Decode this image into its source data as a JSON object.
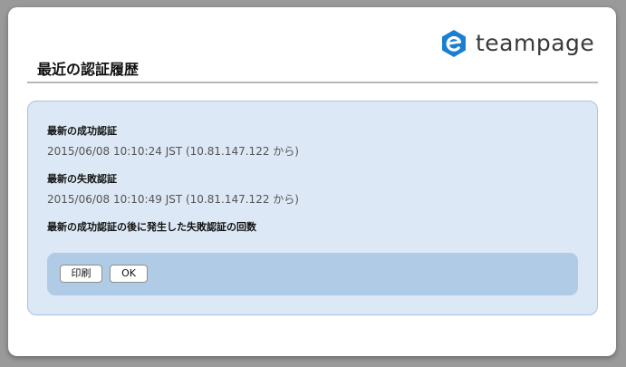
{
  "brand": {
    "name": "teampage",
    "accent_color": "#1a7fd0",
    "logo_icon": "teampage-hexagon-logo-icon"
  },
  "dialog": {
    "title": "最近の認証履歴"
  },
  "history": {
    "last_success_label": "最新の成功認証",
    "last_success_value": "2015/06/08 10:10:24 JST (10.81.147.122 から)",
    "last_failure_label": "最新の失敗認証",
    "last_failure_value": "2015/06/08 10:10:49 JST (10.81.147.122 から)",
    "failures_since_success_label": "最新の成功認証の後に発生した失敗認証の回数"
  },
  "buttons": {
    "print_label": "印刷",
    "ok_label": "OK"
  }
}
